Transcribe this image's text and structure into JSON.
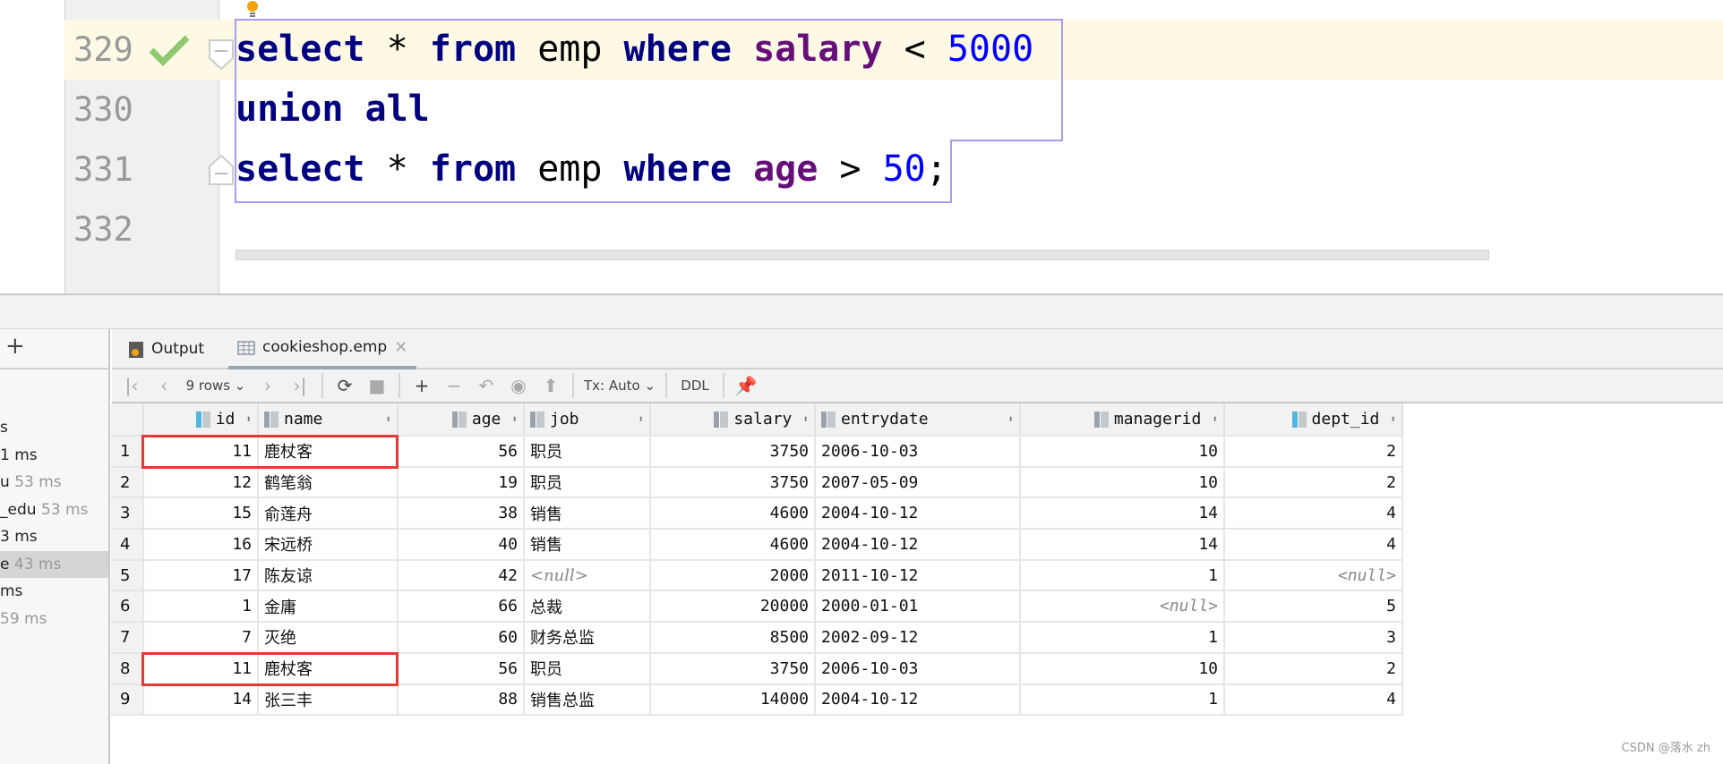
{
  "editor": {
    "lines": [
      {
        "number": "329",
        "tokens": [
          [
            "kw",
            "select"
          ],
          [
            "",
            "*"
          ],
          [
            "kw",
            "from"
          ],
          [
            "",
            "emp"
          ],
          [
            "kw",
            "where"
          ],
          [
            "col",
            "salary"
          ],
          [
            "",
            "<"
          ],
          [
            "num",
            "5000"
          ]
        ]
      },
      {
        "number": "330",
        "tokens": [
          [
            "kw",
            "union"
          ],
          [
            "kw",
            "all"
          ]
        ]
      },
      {
        "number": "331",
        "tokens": [
          [
            "kw",
            "select"
          ],
          [
            "",
            "*"
          ],
          [
            "kw",
            "from"
          ],
          [
            "",
            "emp"
          ],
          [
            "kw",
            "where"
          ],
          [
            "col",
            "age"
          ],
          [
            "",
            ">"
          ],
          [
            "num",
            "50"
          ]
        ],
        "suffix": ";"
      },
      {
        "number": "332",
        "tokens": []
      }
    ],
    "status_icon": "checkmark-icon"
  },
  "left_panel": {
    "items": [
      {
        "name": "s",
        "time": ""
      },
      {
        "name": "1 ms",
        "time": ""
      },
      {
        "name": "u",
        "time": "53 ms"
      },
      {
        "name": "_edu",
        "time": "53 ms"
      },
      {
        "name": "3 ms",
        "time": ""
      },
      {
        "name": "e",
        "time": "43 ms",
        "selected": true
      },
      {
        "name": "ms",
        "time": ""
      },
      {
        "name": "",
        "time": "59 ms"
      }
    ],
    "add_label": "+"
  },
  "tabs": [
    {
      "label": "Output",
      "icon": "output-icon"
    },
    {
      "label": "cookieshop.emp",
      "icon": "table-icon",
      "active": true
    }
  ],
  "toolbar": {
    "rows_label": "9 rows",
    "tx_label": "Tx: Auto",
    "ddl_label": "DDL"
  },
  "table": {
    "columns": [
      "id",
      "name",
      "age",
      "job",
      "salary",
      "entrydate",
      "managerid",
      "dept_id"
    ],
    "rows": [
      [
        "1",
        "11",
        "鹿杖客",
        "56",
        "职员",
        "3750",
        "2006-10-03",
        "10",
        "2"
      ],
      [
        "2",
        "12",
        "鹤笔翁",
        "19",
        "职员",
        "3750",
        "2007-05-09",
        "10",
        "2"
      ],
      [
        "3",
        "15",
        "俞莲舟",
        "38",
        "销售",
        "4600",
        "2004-10-12",
        "14",
        "4"
      ],
      [
        "4",
        "16",
        "宋远桥",
        "40",
        "销售",
        "4600",
        "2004-10-12",
        "14",
        "4"
      ],
      [
        "5",
        "17",
        "陈友谅",
        "42",
        "<null>",
        "2000",
        "2011-10-12",
        "1",
        "<null>"
      ],
      [
        "6",
        "1",
        "金庸",
        "66",
        "总裁",
        "20000",
        "2000-01-01",
        "<null>",
        "5"
      ],
      [
        "7",
        "7",
        "灭绝",
        "60",
        "财务总监",
        "8500",
        "2002-09-12",
        "1",
        "3"
      ],
      [
        "8",
        "11",
        "鹿杖客",
        "56",
        "职员",
        "3750",
        "2006-10-03",
        "10",
        "2"
      ],
      [
        "9",
        "14",
        "张三丰",
        "88",
        "销售总监",
        "14000",
        "2004-10-12",
        "1",
        "4"
      ]
    ],
    "highlighted_rows": [
      1,
      8
    ],
    "highlight_color": "#e53935"
  },
  "watermark": "CSDN @落水 zh"
}
